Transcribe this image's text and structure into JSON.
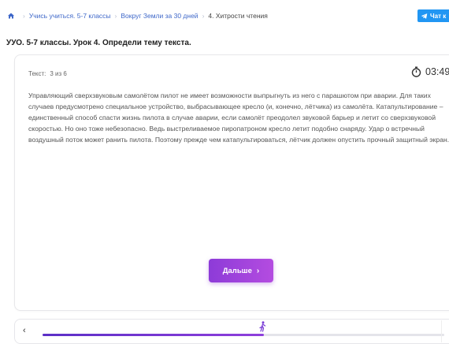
{
  "breadcrumb": {
    "home_icon": "home-icon",
    "items": [
      {
        "label": "Учись учиться. 5-7 классы"
      },
      {
        "label": "Вокруг Земли за 30 дней"
      },
      {
        "label": "4. Хитрости чтения"
      }
    ]
  },
  "telegram_button": {
    "label": "Чат к",
    "icon": "telegram-icon"
  },
  "page_title": "УУО. 5-7 классы. Урок 4. Определи тему текста.",
  "card": {
    "counter_label": "Текст:",
    "counter_value": "3 из 6",
    "timer": "03:49",
    "timer_icon": "stopwatch-icon",
    "passage": "Управляющий сверхзвуковым самолётом пилот не имеет возможности выпрыгнуть из него с парашютом при аварии. Для таких случаев предусмотрено специальное устройство, выбрасывающее кресло (и, конечно, лётчика) из самолёта. Катапультирование – единственный способ спасти жизнь пилота в случае аварии, если самолёт преодолел звуковой барьер и летит со сверхзвуковой скоростью. Но оно тоже небезопасно. Ведь выстреливаемое пиропатроном кресло летит подобно снаряду. Удар о встречный воздушный поток может ранить пилота. Поэтому прежде чем катапультироваться, лётчик должен опустить прочный защитный экран.",
    "next_button": "Дальше"
  },
  "progress": {
    "prev_icon": "chevron-left-icon",
    "marker_icon": "walking-person-icon",
    "value": 0.55
  },
  "colors": {
    "accent": "#8d3bd8",
    "link": "#3f68c9",
    "telegram": "#2196f3"
  }
}
